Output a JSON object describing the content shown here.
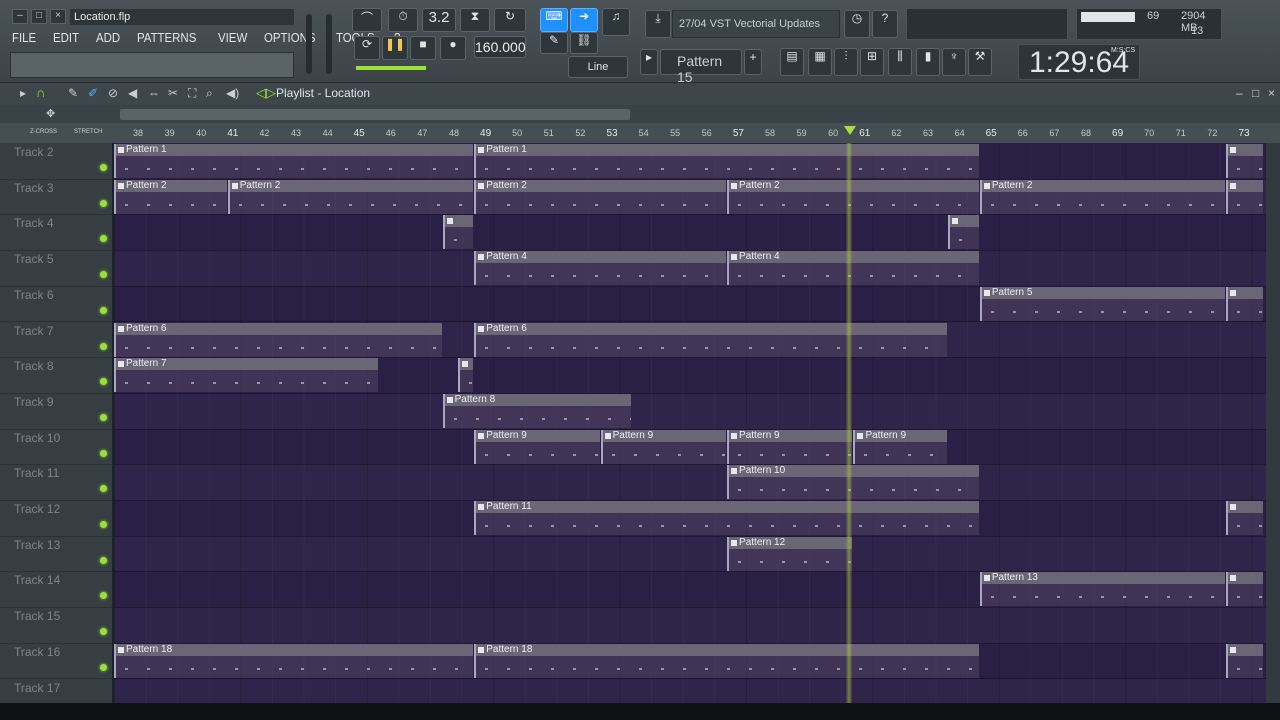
{
  "window": {
    "title": "Location.flp"
  },
  "menu": [
    "FILE",
    "EDIT",
    "ADD",
    "PATTERNS",
    "VIEW",
    "OPTIONS",
    "TOOLS",
    "?"
  ],
  "transport": {
    "tempo": "160.000",
    "snap": "Line",
    "pattern": "Pattern 15",
    "time": "1:29:64",
    "time_unit": "M:S:CS",
    "step_value": "3.2"
  },
  "news": {
    "text": "27/04  VST Vectorial Updates"
  },
  "system": {
    "cpu": "69",
    "memory": "2904 MB",
    "polyphony": "13"
  },
  "playlist": {
    "title": "Playlist - Location",
    "zcross": "Z-CROSS",
    "stretch": "STRETCH"
  },
  "ruler": [
    "38",
    "39",
    "40",
    "41",
    "42",
    "43",
    "44",
    "45",
    "46",
    "47",
    "48",
    "49",
    "50",
    "51",
    "52",
    "53",
    "54",
    "55",
    "56",
    "57",
    "58",
    "59",
    "60",
    "61",
    "62",
    "63",
    "64",
    "65",
    "66",
    "67",
    "68",
    "69",
    "70",
    "71",
    "72",
    "73"
  ],
  "tracks": [
    "Track 2",
    "Track 3",
    "Track 4",
    "Track 5",
    "Track 6",
    "Track 7",
    "Track 8",
    "Track 9",
    "Track 10",
    "Track 11",
    "Track 12",
    "Track 13",
    "Track 14",
    "Track 15",
    "Track 16",
    "Track 17"
  ],
  "colors": {
    "grid_bg": "#2a1f45",
    "playhead": "#a6e03c",
    "accent": "#1e90ff"
  }
}
